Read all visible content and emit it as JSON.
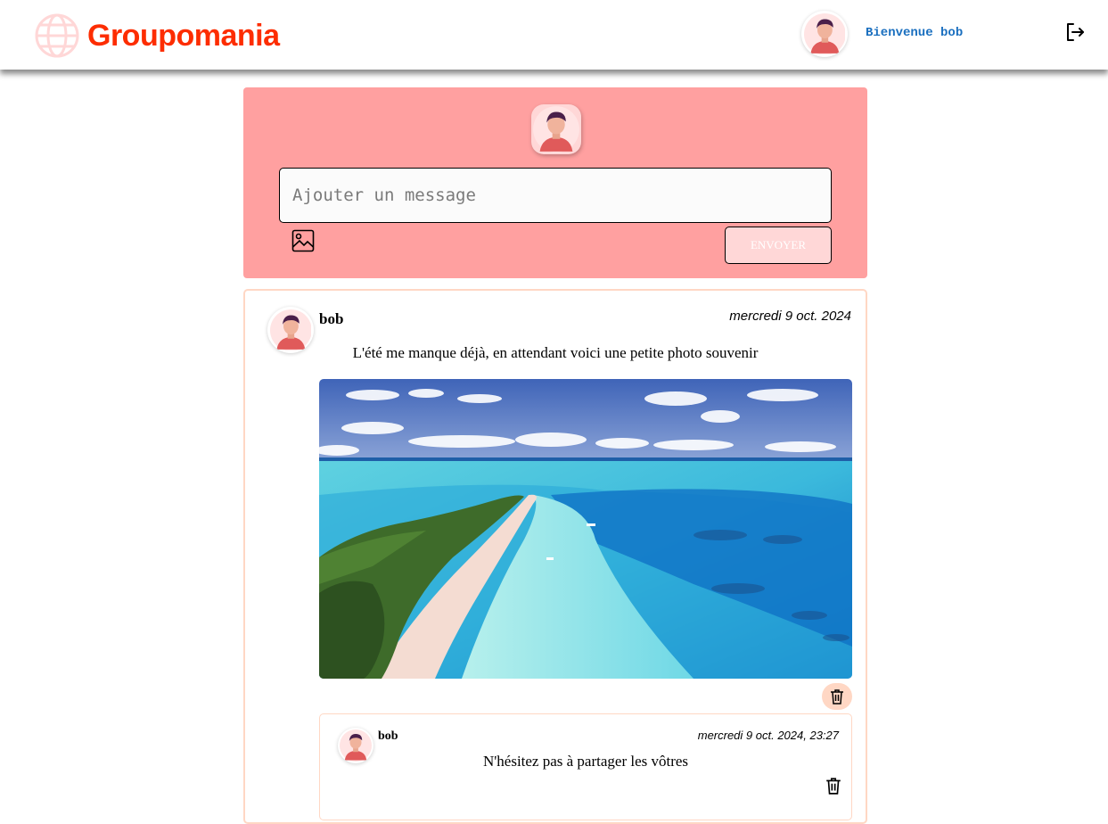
{
  "header": {
    "brand": "Groupomania",
    "welcome": "Bienvenue bob",
    "logo_icon": "globe-icon",
    "logout_icon": "logout-icon"
  },
  "composer": {
    "placeholder": "Ajouter un message",
    "image_icon": "image-icon",
    "send_label": "ENVOYER"
  },
  "post": {
    "author": "bob",
    "date": "mercredi 9 oct. 2024",
    "text": "L'été me manque déjà, en attendant voici une petite photo souvenir",
    "delete_icon": "trash-icon",
    "comment": {
      "author": "bob",
      "date": "mercredi 9 oct. 2024, 23:27",
      "text": "N'hésitez pas à partager les vôtres",
      "delete_icon": "trash-icon"
    }
  },
  "colors": {
    "brand": "#fd2d01",
    "composer_bg": "#ffa0a0",
    "accent_light": "#ffd7d7",
    "welcome": "#1a6fbf"
  }
}
